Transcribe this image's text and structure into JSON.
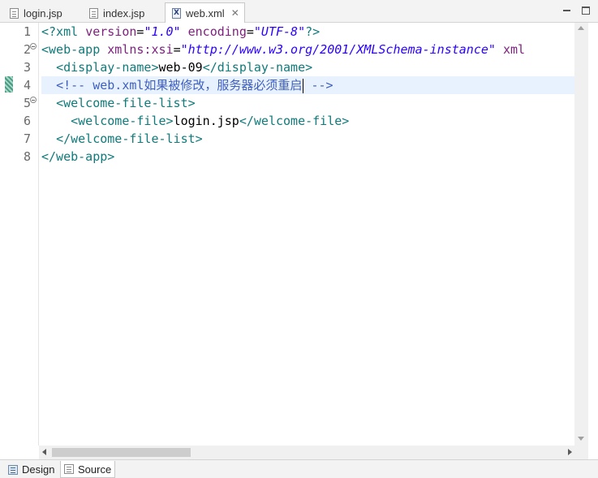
{
  "tabs": [
    {
      "label": "login.jsp",
      "icon": "jsp-file-icon",
      "active": false
    },
    {
      "label": "index.jsp",
      "icon": "jsp-file-icon",
      "active": false
    },
    {
      "label": "web.xml",
      "icon": "xml-file-icon",
      "active": true,
      "close_glyph": "✕"
    }
  ],
  "editor": {
    "line_numbers": [
      "1",
      "2",
      "3",
      "4",
      "5",
      "6",
      "7",
      "8"
    ],
    "current_line": 4,
    "lines": [
      [
        {
          "t": "<?xml ",
          "c": "tg"
        },
        {
          "t": "version",
          "c": "at"
        },
        {
          "t": "=",
          "c": "tx"
        },
        {
          "t": "\"1.0\"",
          "c": "vl"
        },
        {
          "t": " ",
          "c": "tx"
        },
        {
          "t": "encoding",
          "c": "at"
        },
        {
          "t": "=",
          "c": "tx"
        },
        {
          "t": "\"UTF-8\"",
          "c": "vl"
        },
        {
          "t": "?>",
          "c": "tg"
        }
      ],
      [
        {
          "t": "<web-app ",
          "c": "tg"
        },
        {
          "t": "xmlns:xsi",
          "c": "at"
        },
        {
          "t": "=",
          "c": "tx"
        },
        {
          "t": "\"http://www.w3.org/2001/XMLSchema-instance\"",
          "c": "vl"
        },
        {
          "t": " ",
          "c": "tx"
        },
        {
          "t": "xml",
          "c": "at"
        }
      ],
      [
        {
          "t": "  ",
          "c": "tx"
        },
        {
          "t": "<display-name>",
          "c": "tg"
        },
        {
          "t": "web-09",
          "c": "tx"
        },
        {
          "t": "</display-name>",
          "c": "tg"
        }
      ],
      [
        {
          "t": "  ",
          "c": "tx"
        },
        {
          "t": "<!-- web.xml如果被修改，服务器必须重启",
          "c": "cm"
        },
        {
          "t": "",
          "c": "caret"
        },
        {
          "t": " -->",
          "c": "cm"
        }
      ],
      [
        {
          "t": "  ",
          "c": "tx"
        },
        {
          "t": "<welcome-file-list>",
          "c": "tg"
        }
      ],
      [
        {
          "t": "    ",
          "c": "tx"
        },
        {
          "t": "<welcome-file>",
          "c": "tg"
        },
        {
          "t": "login.jsp",
          "c": "tx"
        },
        {
          "t": "</welcome-file>",
          "c": "tg"
        }
      ],
      [
        {
          "t": "  ",
          "c": "tx"
        },
        {
          "t": "</welcome-file-list>",
          "c": "tg"
        }
      ],
      [
        {
          "t": "</web-app>",
          "c": "tg"
        }
      ]
    ],
    "folding_lines": [
      2,
      5
    ]
  },
  "bottom_tabs": [
    {
      "label": "Design",
      "icon": "design-icon",
      "active": false
    },
    {
      "label": "Source",
      "icon": "source-icon",
      "active": true
    }
  ],
  "colors": {
    "tag": "#117a7a",
    "attribute": "#7d1f7d",
    "value": "#2a00ff",
    "comment": "#3f5fbf",
    "current_line_bg": "#e8f2fe"
  }
}
